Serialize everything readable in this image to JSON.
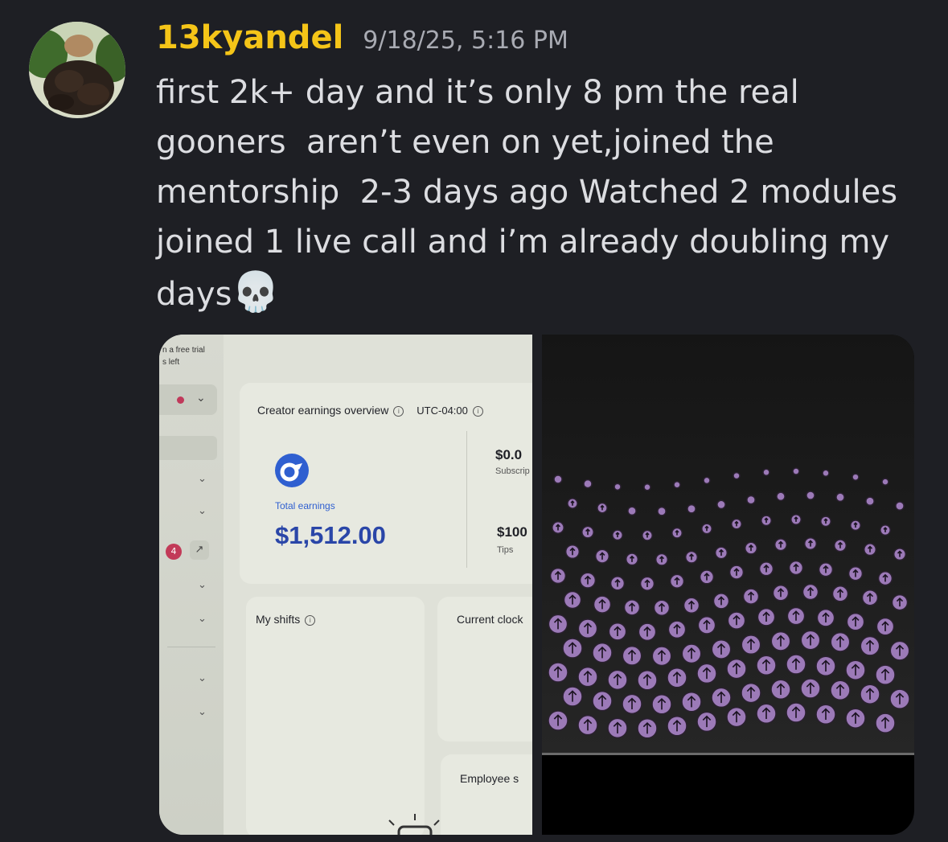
{
  "message": {
    "username": "13kyandel",
    "timestamp": "9/18/25, 5:16 PM",
    "text": "first 2k+ day and it’s only 8 pm the real\ngooners  aren’t even on yet,joined the\nmentorship  2-3 days ago Watched 2 modules\njoined 1 live call and i’m already doubling my\ndays",
    "emoji": "💀"
  },
  "attachment_dashboard": {
    "trial_line1": "n a free trial",
    "trial_line2": "s left",
    "notification_count": "4",
    "earnings_title": "Creator earnings overview",
    "timezone": "UTC-04:00",
    "total_label": "Total earnings",
    "total_value": "$1,512.00",
    "subscriptions_value": "$0.0",
    "subscriptions_label": "Subscrip",
    "tips_value": "$100",
    "tips_label": "Tips",
    "shifts_title": "My shifts",
    "clock_title": "Current clock",
    "employee_title": "Employee s"
  },
  "colors": {
    "background": "#1e1f24",
    "username": "#f5c518",
    "timestamp": "#a9abb3",
    "text": "#dcdde1",
    "earnings_blue": "#2a46a8",
    "badge_red": "#c23a58",
    "bubble_purple": "#9c7ab8"
  }
}
